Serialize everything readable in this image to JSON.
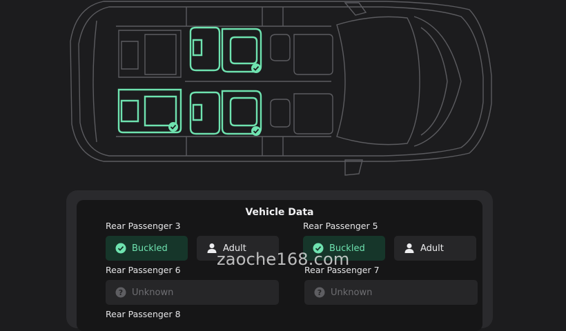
{
  "panel": {
    "title": "Vehicle Data"
  },
  "passengers": [
    {
      "label": "Rear Passenger 3",
      "status": "Buckled",
      "occupant": "Adult"
    },
    {
      "label": "Rear Passenger 5",
      "status": "Buckled",
      "occupant": "Adult"
    },
    {
      "label": "Rear Passenger 6",
      "status": "Unknown"
    },
    {
      "label": "Rear Passenger 7",
      "status": "Unknown"
    },
    {
      "label": "Rear Passenger 8"
    }
  ],
  "watermark": "zaoche168.com",
  "colors": {
    "background": "#1c1c1e",
    "accent_green": "#6fe3b0",
    "car_outline": "#5a5a5e",
    "buckled_chip": "#16362a",
    "neutral_chip": "#262628"
  },
  "icons": {
    "buckled": "check-circle-icon",
    "occupant": "person-icon",
    "unknown": "question-circle-icon",
    "seat_indicator": "check-badge-icon"
  }
}
